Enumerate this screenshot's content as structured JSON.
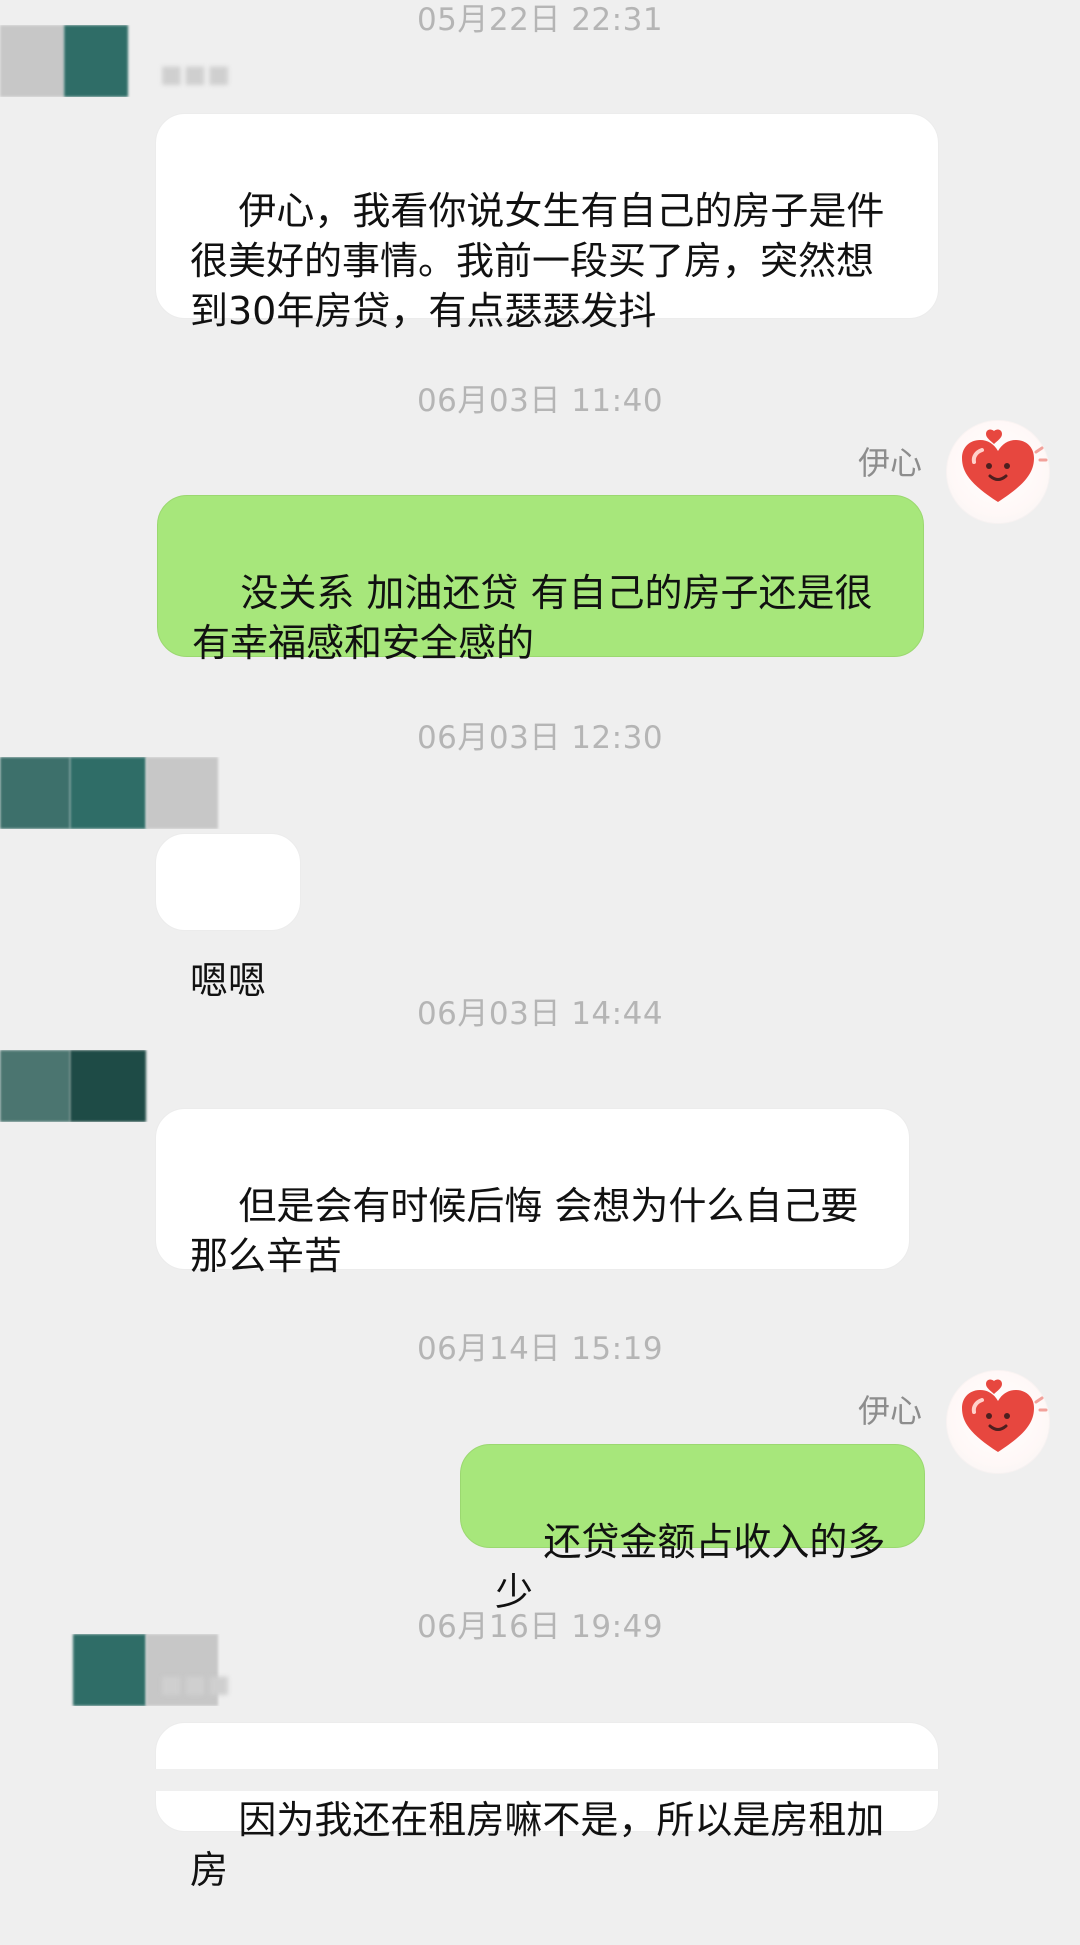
{
  "timestamps": [
    "05月22日 22:31",
    "06月03日 11:40",
    "06月03日 12:30",
    "06月03日 14:44",
    "06月14日 15:19",
    "06月16日 19:49"
  ],
  "right_sender_name": "伊心",
  "messages": [
    {
      "id": "m1",
      "side": "left",
      "text": "伊心，我看你说女生有自己的房子是件很美好的事情。我前一段买了房，突然想到30年房贷，有点瑟瑟发抖"
    },
    {
      "id": "m2",
      "side": "right",
      "text": "没关系 加油还贷 有自己的房子还是很有幸福感和安全感的"
    },
    {
      "id": "m3",
      "side": "left",
      "text": "嗯嗯"
    },
    {
      "id": "m4",
      "side": "left",
      "text": "但是会有时候后悔 会想为什么自己要那么辛苦"
    },
    {
      "id": "m5",
      "side": "right",
      "text": "还贷金额占收入的多少"
    },
    {
      "id": "m6",
      "side": "left",
      "text": "因为我还在租房嘛不是，所以是房租加房"
    }
  ]
}
